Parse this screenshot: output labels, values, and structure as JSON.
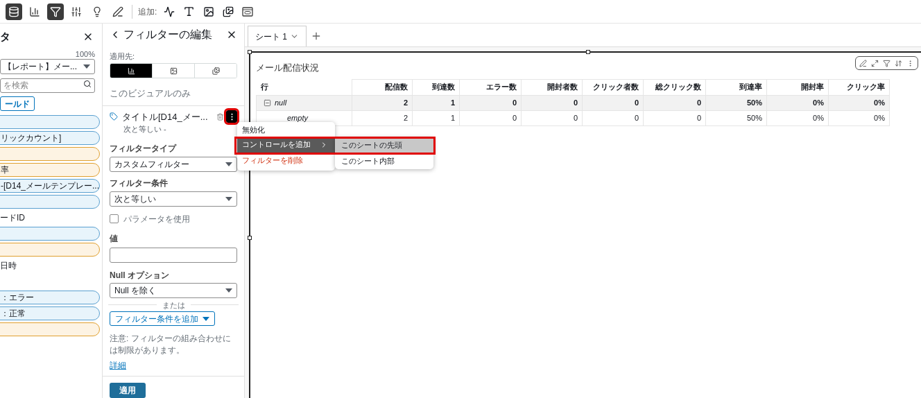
{
  "toolbar": {
    "tools": [
      {
        "selected": true
      },
      {
        "selected": false
      },
      {
        "selected": true
      },
      {
        "selected": false
      },
      {
        "selected": false
      },
      {
        "selected": false
      }
    ],
    "add_label": "追加:"
  },
  "fields_panel": {
    "title": "タ",
    "zoom": "100%",
    "dataset": "【レポート】メー...",
    "search_placeholder": "を検索",
    "field_button": "ールド",
    "items": [
      {
        "kind": "pill",
        "color": "#e8f4fb"
      },
      {
        "kind": "pill",
        "label": "リックカウント]",
        "color": "#e8f4fb"
      },
      {
        "kind": "pill",
        "color": "#fdf3e3"
      },
      {
        "kind": "pill",
        "label": "率",
        "color": "#fdf3e3"
      },
      {
        "kind": "pill",
        "label": "-[D14_メールテンプレー...",
        "color": "#e8f4fb"
      },
      {
        "kind": "pill",
        "color": "#e8f4fb"
      },
      {
        "kind": "text",
        "label": "ードID"
      },
      {
        "kind": "pill",
        "color": "#e8f4fb"
      },
      {
        "kind": "pill",
        "color": "#fdf3e3"
      },
      {
        "kind": "text",
        "label": "日時"
      },
      {
        "kind": "text"
      },
      {
        "kind": "pill",
        "label": "：エラー",
        "color": "#e8f4fb"
      },
      {
        "kind": "pill",
        "label": "：正常",
        "color": "#e8f4fb"
      },
      {
        "kind": "pill",
        "color": "#fdf3e3"
      }
    ]
  },
  "filter_panel": {
    "title": "フィルターの編集",
    "apply_to_label": "適用先:",
    "apply_to": [
      {
        "selected": true
      },
      {
        "selected": false
      },
      {
        "selected": false
      }
    ],
    "scope": "このビジュアルのみ",
    "filter": {
      "title": "タイトル[D14_メー...",
      "subtitle": "次と等しい -",
      "menu_highlighted": true
    },
    "filter_type": {
      "label": "フィルタータイプ",
      "value": "カスタムフィルター"
    },
    "condition": {
      "label": "フィルター条件",
      "value": "次と等しい"
    },
    "use_parameter": {
      "label": "パラメータを使用",
      "checked": false
    },
    "value": {
      "label": "値"
    },
    "null_option": {
      "label": "Null オプション",
      "value": "Null を除く"
    },
    "or_label": "または",
    "add_condition": "フィルター条件を追加",
    "note": "注意: フィルターの組み合わせには制限があります。",
    "details_link": "詳細",
    "apply": "適用"
  },
  "context_menu": {
    "highlighted": true,
    "items": [
      {
        "kind": "plain",
        "label": "無効化",
        "selected": false
      },
      {
        "kind": "submenu",
        "label": "コントロールを追加",
        "selected": true
      },
      {
        "kind": "danger",
        "label": "フィルターを削除",
        "selected": false
      }
    ],
    "submenu": [
      {
        "label": "このシートの先頭",
        "selected": true
      },
      {
        "label": "このシート内部",
        "selected": false
      }
    ]
  },
  "sheet_tabs": [
    {
      "label": "シート 1",
      "selected": true
    }
  ],
  "visual": {
    "title": "メール配信状況",
    "columns": [
      "行",
      "配信数",
      "到達数",
      "エラー数",
      "開封者数",
      "クリック者数",
      "総クリック数",
      "到達率",
      "開封率",
      "クリック率"
    ],
    "rows": [
      {
        "kind": "group",
        "expanded": true,
        "cells": [
          "null",
          "2",
          "1",
          "0",
          "0",
          "0",
          "0",
          "50%",
          "0%",
          "0%"
        ]
      },
      {
        "kind": "child",
        "cells": [
          "empty",
          "2",
          "1",
          "0",
          "0",
          "0",
          "0",
          "50%",
          "0%",
          "0%"
        ]
      }
    ]
  }
}
